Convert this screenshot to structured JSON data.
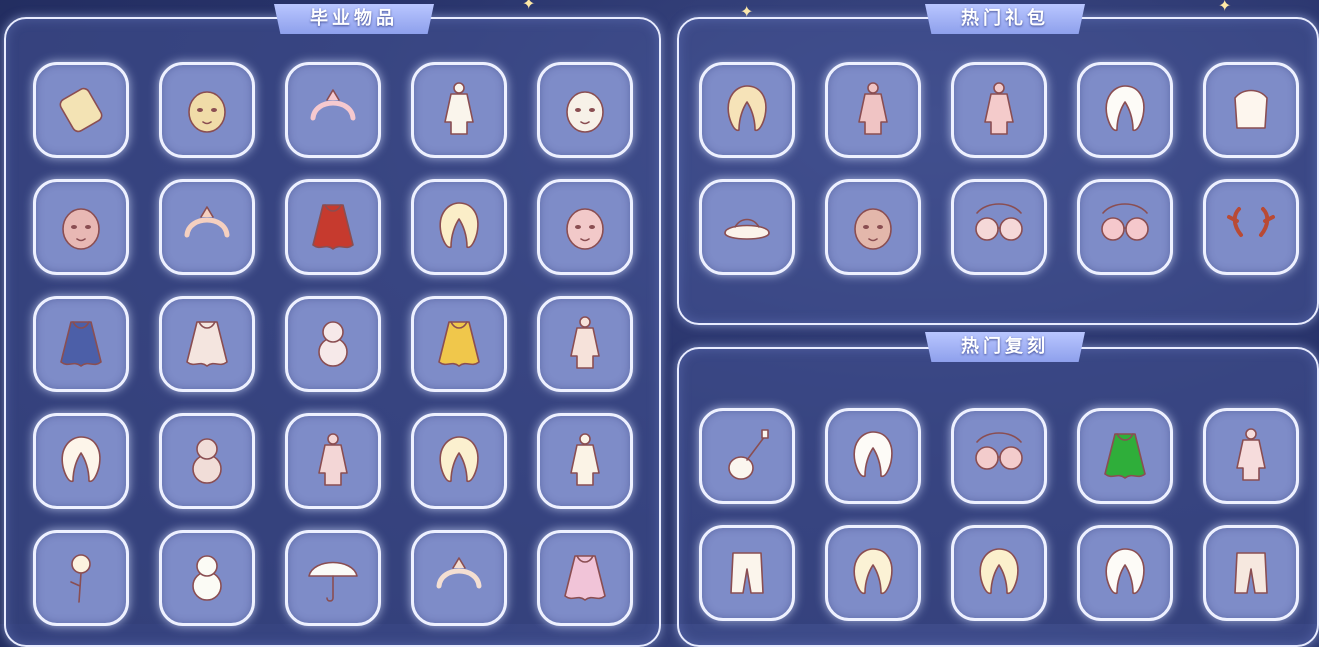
{
  "panels": [
    {
      "id": "graduation",
      "title": "毕业物品",
      "items": [
        {
          "icon": "scroll-icon",
          "color": "#f3e3b4"
        },
        {
          "icon": "golden-mask-icon",
          "color": "#f0dca8"
        },
        {
          "icon": "winged-headband-icon",
          "color": "#f6c9cf"
        },
        {
          "icon": "white-outfit-icon",
          "color": "#faf5ec"
        },
        {
          "icon": "bird-mask-icon",
          "color": "#f7f1e8"
        },
        {
          "icon": "round-hood-mask-icon",
          "color": "#e8b8b4"
        },
        {
          "icon": "pendant-necklace-icon",
          "color": "#f5d0c0"
        },
        {
          "icon": "red-cape-icon",
          "color": "#c63a2e"
        },
        {
          "icon": "blonde-hair-icon",
          "color": "#fbeec8"
        },
        {
          "icon": "horned-mask-icon",
          "color": "#f2c9c9"
        },
        {
          "icon": "blue-cape-icon",
          "color": "#4c5fa8"
        },
        {
          "icon": "harness-cape-icon",
          "color": "#f4e5df"
        },
        {
          "icon": "lantern-prop-icon",
          "color": "#f6e9e9"
        },
        {
          "icon": "golden-scarf-icon",
          "color": "#f0c74b"
        },
        {
          "icon": "dress-outfit-icon",
          "color": "#f6e2da"
        },
        {
          "icon": "bun-hair-icon",
          "color": "#fdf5ea"
        },
        {
          "icon": "figure-statue-icon",
          "color": "#f1ddd8"
        },
        {
          "icon": "pink-robe-icon",
          "color": "#f3d6d6"
        },
        {
          "icon": "spiky-hair-icon",
          "color": "#fbf0cf"
        },
        {
          "icon": "white-robe-icon",
          "color": "#fbf3e6"
        },
        {
          "icon": "rose-flower-icon",
          "color": "#fcf3df"
        },
        {
          "icon": "moomin-plush-icon",
          "color": "#fbfbf5"
        },
        {
          "icon": "umbrella-icon",
          "color": "#fbfbf7"
        },
        {
          "icon": "crown-headdress-icon",
          "color": "#f4dfd2"
        },
        {
          "icon": "pink-cape-icon",
          "color": "#f1c4d8"
        }
      ]
    },
    {
      "id": "hot-packs",
      "title": "热门礼包",
      "items": [
        {
          "icon": "ponytail-hair-icon",
          "color": "#f6e3b8"
        },
        {
          "icon": "pink-outfit-icon",
          "color": "#f0c4c4"
        },
        {
          "icon": "pink-gown-icon",
          "color": "#f4cbcb"
        },
        {
          "icon": "bunny-hair-icon",
          "color": "#fdfbf7"
        },
        {
          "icon": "fluffy-top-icon",
          "color": "#fdf6ee"
        },
        {
          "icon": "sandals-icon",
          "color": "#fbf3ea"
        },
        {
          "icon": "face-emote-icon",
          "color": "#e3b7ab"
        },
        {
          "icon": "round-glasses-icon",
          "color": "#f5d8d8"
        },
        {
          "icon": "heart-glasses-icon",
          "color": "#f5c8cc"
        },
        {
          "icon": "antlers-icon",
          "color": "#b94a34"
        }
      ]
    },
    {
      "id": "hot-reruns",
      "title": "热门复刻",
      "items": [
        {
          "icon": "ukulele-icon",
          "color": "#fbf6ef"
        },
        {
          "icon": "twin-tail-hair-icon",
          "color": "#fdfbf7"
        },
        {
          "icon": "sunglasses-icon",
          "color": "#f3cccc"
        },
        {
          "icon": "green-cape-icon",
          "color": "#2fae3a"
        },
        {
          "icon": "light-outfit-icon",
          "color": "#f6dcdc"
        },
        {
          "icon": "puffy-pants-icon",
          "color": "#fbf5ec"
        },
        {
          "icon": "wavy-hair-icon",
          "color": "#fbf2d5"
        },
        {
          "icon": "bob-hair-icon",
          "color": "#fbf0cc"
        },
        {
          "icon": "cat-ear-hair-icon",
          "color": "#fdfbf7"
        },
        {
          "icon": "cargo-pants-icon",
          "color": "#f6e8df"
        }
      ]
    }
  ]
}
